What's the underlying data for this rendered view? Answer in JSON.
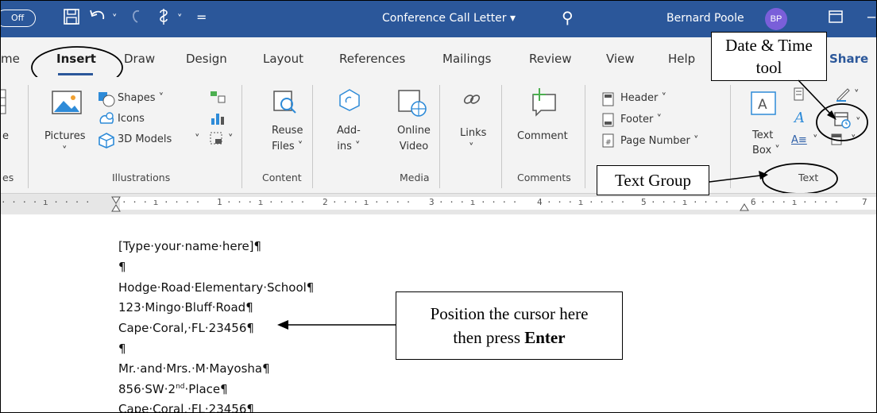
{
  "titlebar": {
    "autosave_label": "Off",
    "document_title": "Conference Call Letter ▾",
    "user_name": "Bernard Poole",
    "avatar_initials": "BP",
    "save_icon": "save-icon",
    "undo_icon": "undo-icon",
    "redo_icon": "redo-icon"
  },
  "tabs": [
    "me",
    "Insert",
    "Draw",
    "Design",
    "Layout",
    "References",
    "Mailings",
    "Review",
    "View",
    "Help",
    "Share"
  ],
  "ribbon": {
    "pages_partial": "e",
    "groups": {
      "pages_partial": "es",
      "illustrations": "Illustrations",
      "content": "Content",
      "media": "Media",
      "comments": "Comments",
      "text": "Text"
    },
    "pictures_label": "Pictures",
    "shapes_label": "Shapes ˅",
    "icons_label": "Icons",
    "models_label": "3D Models",
    "reuse_files_label": "Reuse\nFiles ˅",
    "addins_label": "Add-\nins ˅",
    "online_video_label": "Online\nVideo",
    "links_label": "Links",
    "comment_label": "Comment",
    "header_label": "Header ˅",
    "footer_label": "Footer ˅",
    "page_number_label": "Page Number ˅",
    "text_box_label": "Text\nBox ˅"
  },
  "ruler": {
    "numbers": [
      "1",
      "2",
      "3",
      "4",
      "5",
      "6",
      "7"
    ]
  },
  "document": {
    "lines": [
      "[Type·your·name·here]¶",
      "¶",
      "Hodge·Road·Elementary·School¶",
      "123·Mingo·Bluff·Road¶",
      "Cape·Coral,·FL·23456¶",
      "¶",
      "Mr.·and·Mrs.·M·Mayosha¶",
      "856·SW·2",
      "Cape·Coral,·FL·23456¶"
    ],
    "superscript": "nd",
    "line8_tail": "·Place¶"
  },
  "callouts": {
    "date_time": "Date & Time tool",
    "date_time_line1": "Date & Time",
    "date_time_line2": "tool",
    "text_group": "Text Group",
    "cursor_line1": "Position the cursor here",
    "cursor_line2_prefix": "then press ",
    "cursor_line2_bold": "Enter"
  },
  "colors": {
    "title_bar": "#2b579a",
    "ribbon_bg": "#f3f3f3",
    "avatar": "#7a5fd9"
  }
}
